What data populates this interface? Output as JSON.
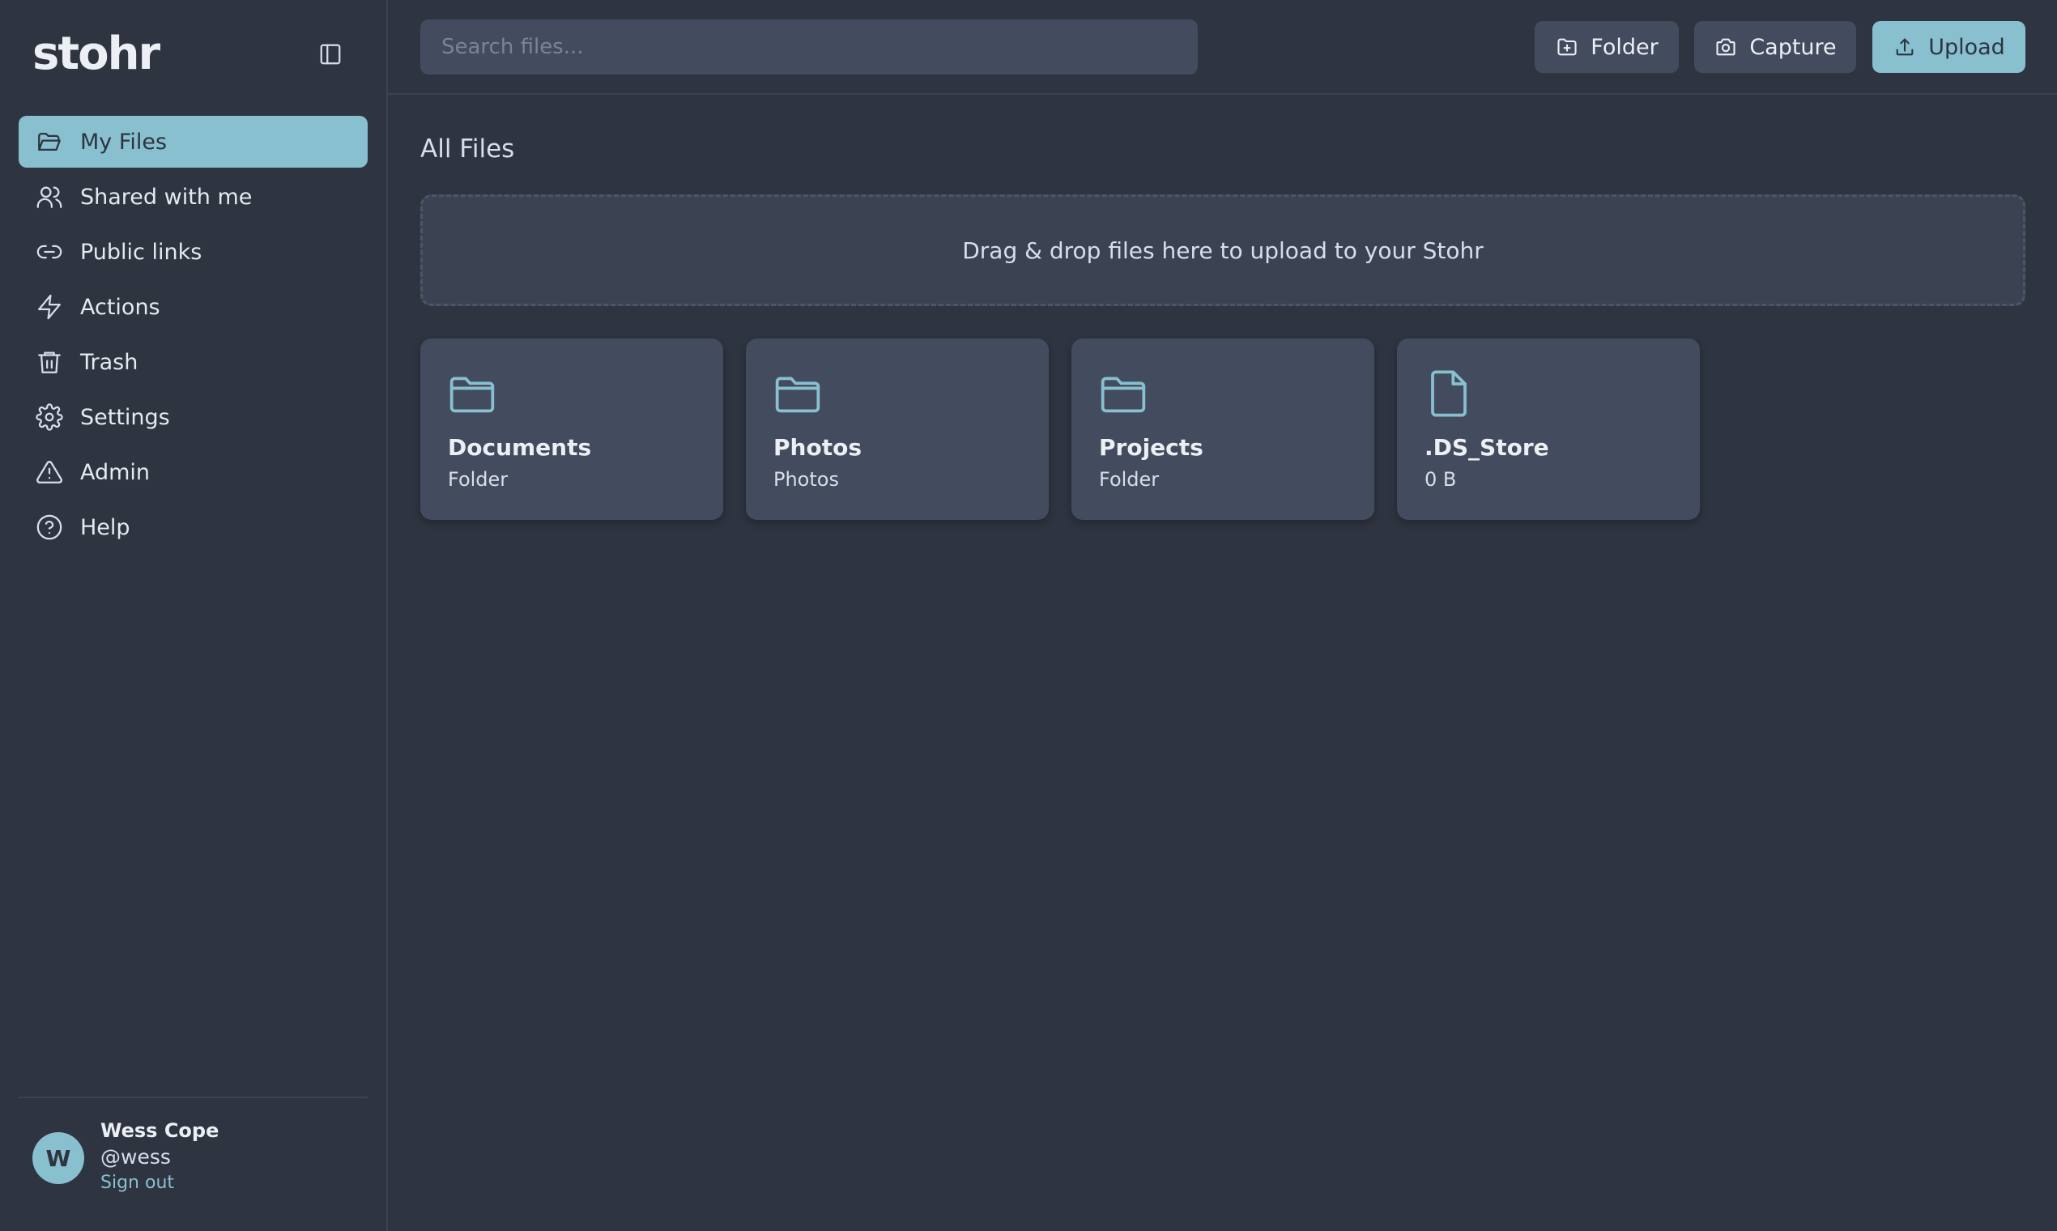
{
  "app": {
    "brand": "stohr"
  },
  "sidebar": {
    "items": [
      {
        "label": "My Files",
        "icon": "folder-open-icon",
        "active": true
      },
      {
        "label": "Shared with me",
        "icon": "users-icon"
      },
      {
        "label": "Public links",
        "icon": "link-icon"
      },
      {
        "label": "Actions",
        "icon": "lightning-icon"
      },
      {
        "label": "Trash",
        "icon": "trash-icon"
      },
      {
        "label": "Settings",
        "icon": "gear-icon"
      },
      {
        "label": "Admin",
        "icon": "warning-icon"
      },
      {
        "label": "Help",
        "icon": "help-circle-icon"
      }
    ],
    "user": {
      "initial": "W",
      "name": "Wess Cope",
      "handle": "@wess",
      "sign_out": "Sign out"
    }
  },
  "topbar": {
    "search_placeholder": "Search files...",
    "folder_label": "Folder",
    "capture_label": "Capture",
    "upload_label": "Upload"
  },
  "main": {
    "title": "All Files",
    "dropzone": "Drag & drop files here to upload to your Stohr",
    "files": [
      {
        "name": "Documents",
        "sub": "Folder",
        "icon": "folder-icon"
      },
      {
        "name": "Photos",
        "sub": "Photos",
        "icon": "folder-icon"
      },
      {
        "name": "Projects",
        "sub": "Folder",
        "icon": "folder-icon"
      },
      {
        "name": ".DS_Store",
        "sub": "0 B",
        "icon": "file-icon"
      }
    ]
  },
  "colors": {
    "background": "#2e3440",
    "accent": "#88c0d0",
    "card": "#434c5e"
  }
}
